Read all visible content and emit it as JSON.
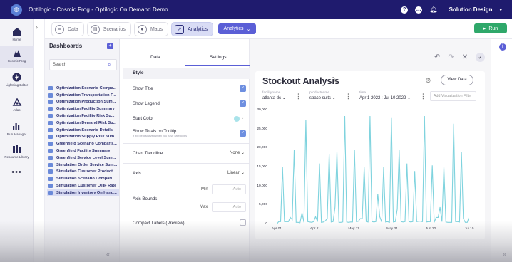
{
  "app": {
    "title": "Optilogic - Cosmic Frog - Optilogic On Demand Demo",
    "user": "Solution Design",
    "brand_color": "#1f1b6e",
    "accent_color": "#5b5fd6"
  },
  "rail": [
    {
      "label": "Home",
      "icon": "home-icon"
    },
    {
      "label": "Cosmic Frog",
      "icon": "frog-icon"
    },
    {
      "label": "Lightning Editor",
      "icon": "lightning-icon"
    },
    {
      "label": "Atlas",
      "icon": "atlas-icon"
    },
    {
      "label": "Run Manager",
      "icon": "run-manager-icon"
    },
    {
      "label": "Resource Library",
      "icon": "library-icon"
    }
  ],
  "module_tabs": [
    {
      "label": "Data",
      "icon": "database-icon"
    },
    {
      "label": "Scenarios",
      "icon": "scenarios-icon"
    },
    {
      "label": "Maps",
      "icon": "map-pin-icon"
    },
    {
      "label": "Analytics",
      "icon": "chart-icon",
      "active": true
    }
  ],
  "analytics_dropdown": "Analytics",
  "run_button": "Run",
  "dashboards": {
    "title": "Dashboards",
    "search_placeholder": "Search",
    "items": [
      "Optimization Scenario Compa...",
      "Optimization Transportation F...",
      "Optimization Production Sum...",
      "Optimization Facility Summary",
      "Optimization Facility Risk Su...",
      "Optimization Demand Risk Su...",
      "Optimization Scenario Details",
      "Optimization Supply Risk Sum...",
      "Greenfield Scenario Comparis...",
      "Greenfield Facility Summary",
      "Greenfield Service Level Sum...",
      "Simulation Order Service Sum...",
      "Simulation Customer Product ...",
      "Simulation Scenario Compari...",
      "Simulation Customer OTIF Rate",
      "Simulation Inventory On Hand..."
    ],
    "selected_index": 15
  },
  "settings": {
    "tab_data": "Data",
    "tab_settings": "Settings",
    "section_style": "Style",
    "show_title": "Show Title",
    "show_legend": "Show Legend",
    "start_color": "Start Color",
    "start_color_value": "#a9e3ea",
    "show_totals": "Show Totals on Tooltip",
    "show_totals_sub": "It will be displayed when you have categories",
    "chart_trendline": "Chart Trendline",
    "chart_trendline_value": "None",
    "axis": "Axis",
    "axis_value": "Linear",
    "axis_bounds": "Axis Bounds",
    "min_label": "Min",
    "max_label": "Max",
    "min_placeholder": "Auto",
    "max_placeholder": "Auto",
    "compact_labels": "Compact Labels (Preview)",
    "show_title_checked": true,
    "show_legend_checked": true,
    "show_totals_checked": true,
    "compact_labels_checked": false
  },
  "chart_card": {
    "view_data": "View Data",
    "add_filter_placeholder": "Add Visualization Filter",
    "filters": [
      {
        "label": "facilityname",
        "value": "atlanta dc"
      },
      {
        "label": "productname",
        "value": "space suits"
      },
      {
        "label": "time",
        "value": "Apr 1 2022 : Jul 10 2022"
      }
    ]
  },
  "chart_data": {
    "type": "line",
    "title": "Stockout Analysis",
    "xlabel": "",
    "ylabel": "",
    "ylim": [
      0,
      30000
    ],
    "yticks": [
      "30,000",
      "25,000",
      "20,000",
      "15,000",
      "10,000",
      "5,000",
      "0"
    ],
    "xticks": [
      "Apr 01",
      "Apr 21",
      "May 11",
      "May 31",
      "Jun 20",
      "Jul 10"
    ],
    "series_color": "#7fd3de",
    "series": [
      {
        "values": [
          0,
          700,
          700,
          15000,
          700,
          700,
          700,
          1800,
          1200,
          19500,
          500,
          500,
          400,
          3000,
          500,
          27500,
          700,
          600,
          500,
          700,
          2000,
          700,
          16000,
          500,
          600,
          900,
          1500,
          18500,
          600,
          700,
          4500,
          19000,
          500,
          500,
          600,
          28500,
          600,
          500,
          600,
          600,
          19500,
          700,
          800,
          1500,
          1500,
          15000,
          700,
          600,
          28500,
          700,
          600,
          700,
          8000,
          2000,
          600,
          15000,
          600,
          700,
          500,
          28000,
          600,
          700,
          4000,
          19500,
          700,
          600,
          700,
          16000,
          700,
          600,
          700,
          14000,
          700,
          800,
          800,
          700,
          28500,
          600,
          700,
          700,
          15500,
          500,
          1800,
          1800,
          4500,
          700,
          15000,
          600,
          500,
          500,
          500,
          26500,
          700,
          700,
          600,
          19000,
          1500,
          500,
          500,
          2000
        ]
      }
    ]
  }
}
